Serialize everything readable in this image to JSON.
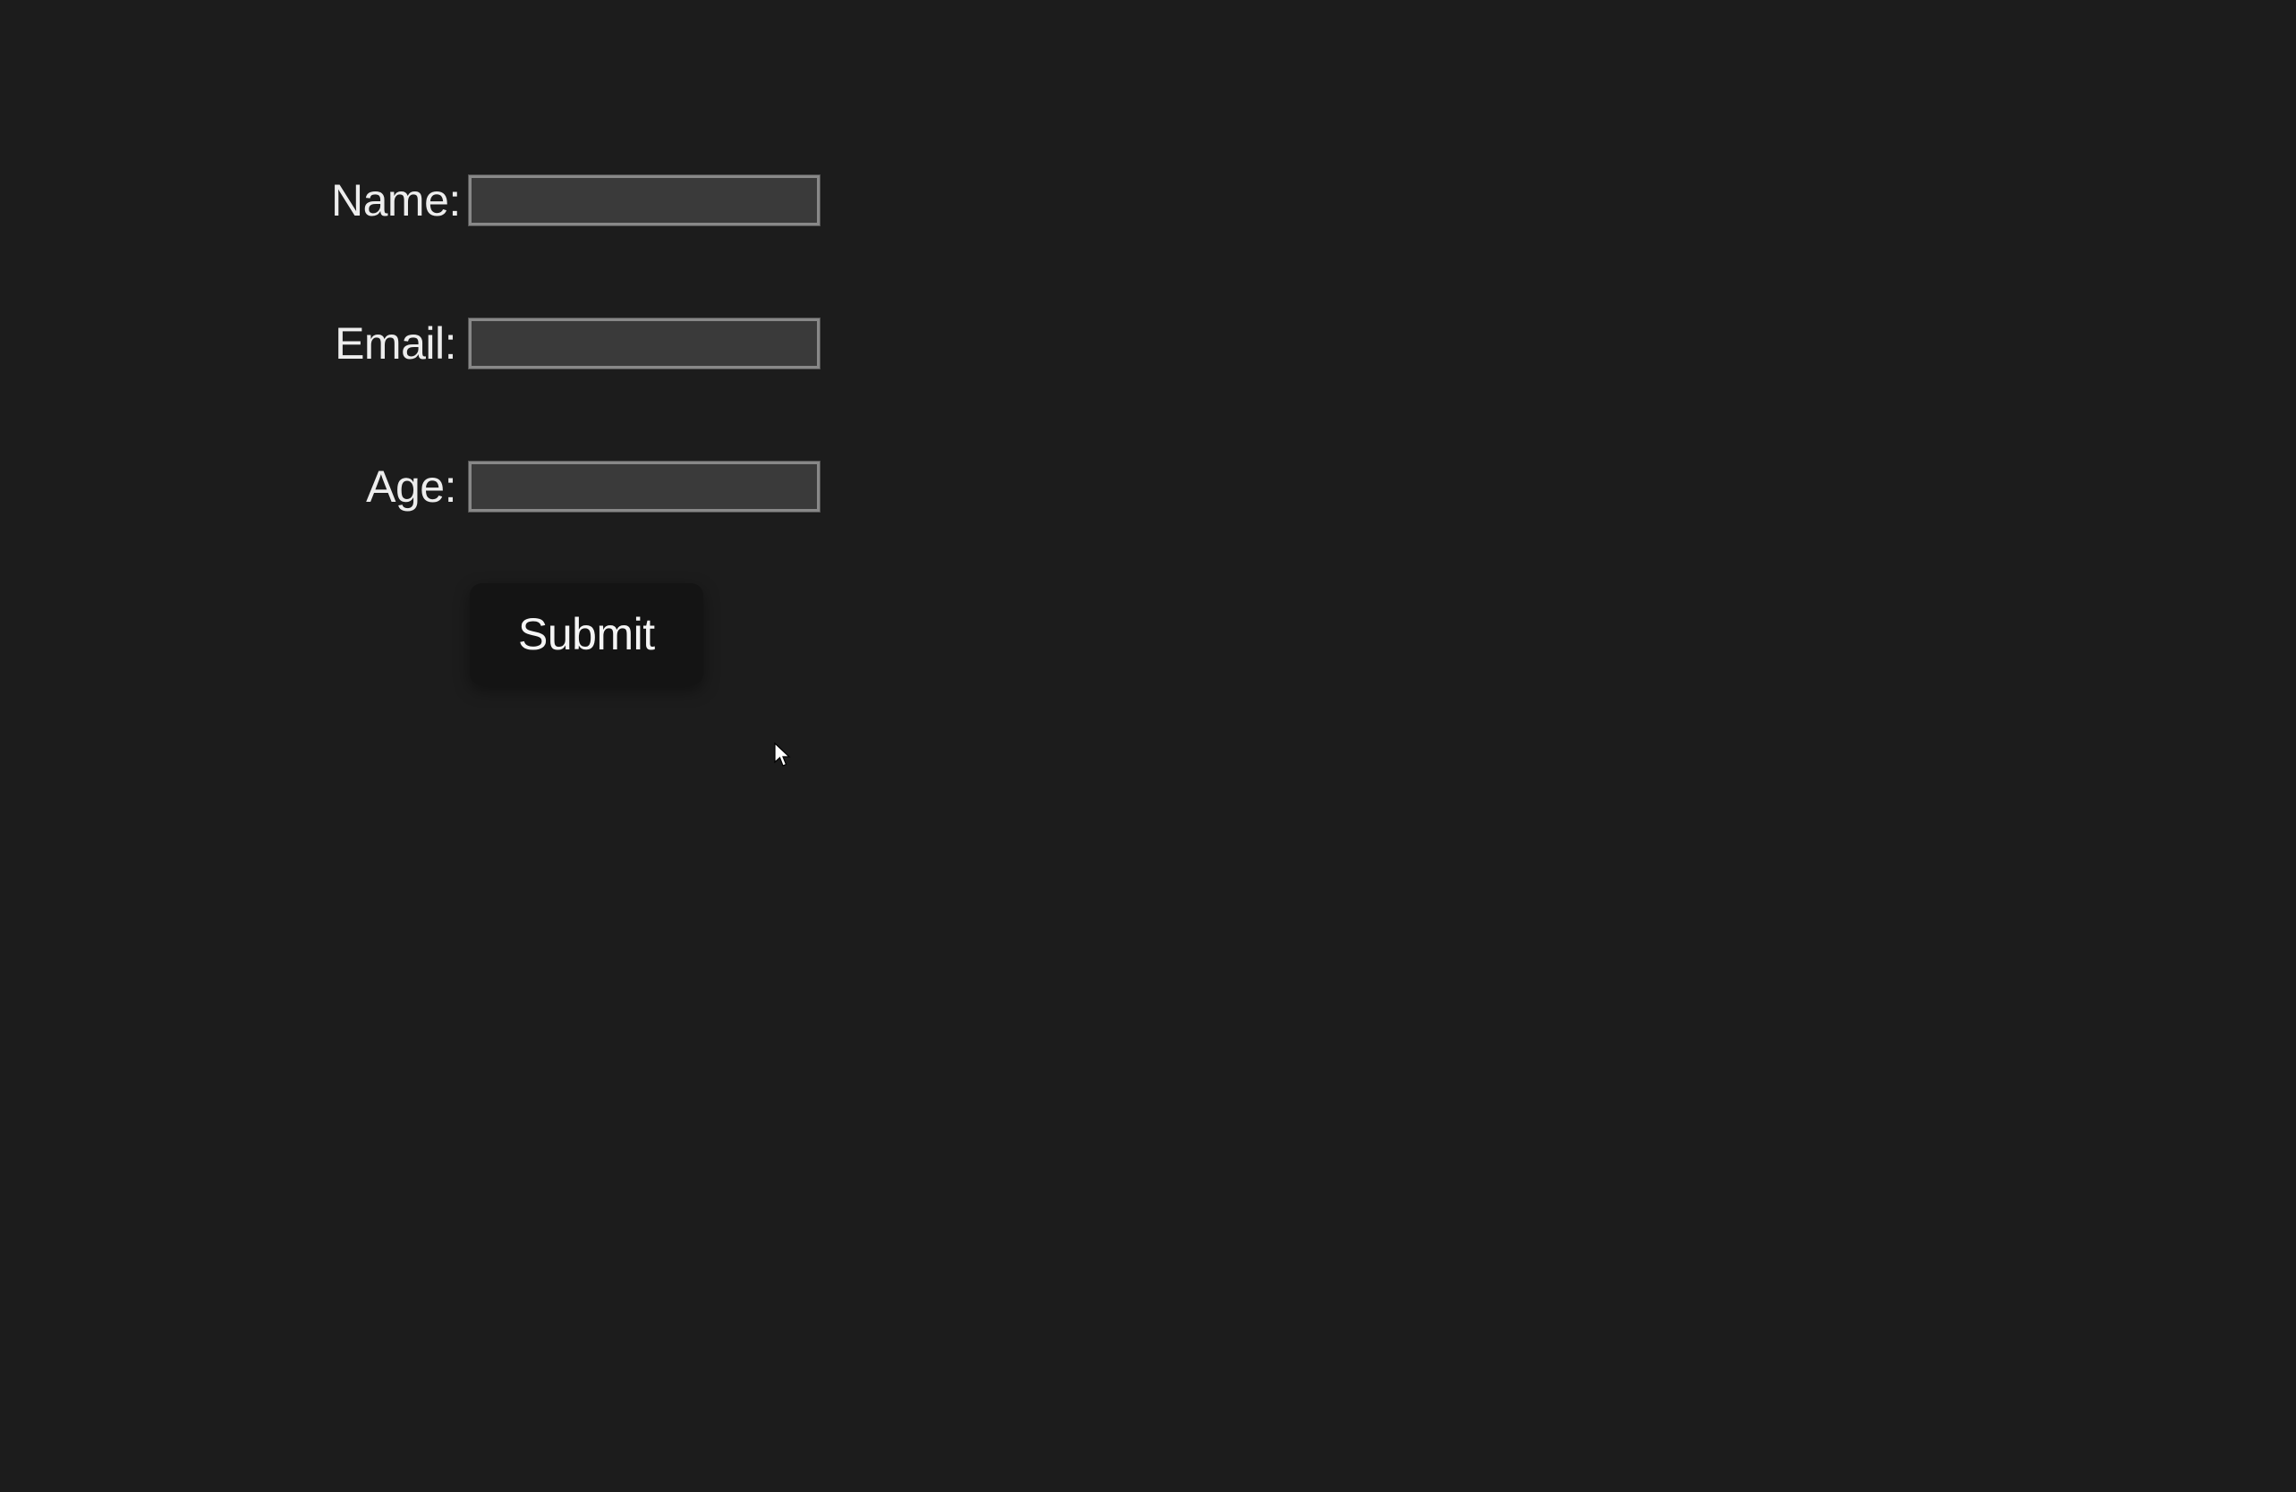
{
  "form": {
    "fields": {
      "name": {
        "label": "Name:",
        "value": ""
      },
      "email": {
        "label": "Email:",
        "value": ""
      },
      "age": {
        "label": "Age:",
        "value": ""
      }
    },
    "submit_label": "Submit"
  }
}
